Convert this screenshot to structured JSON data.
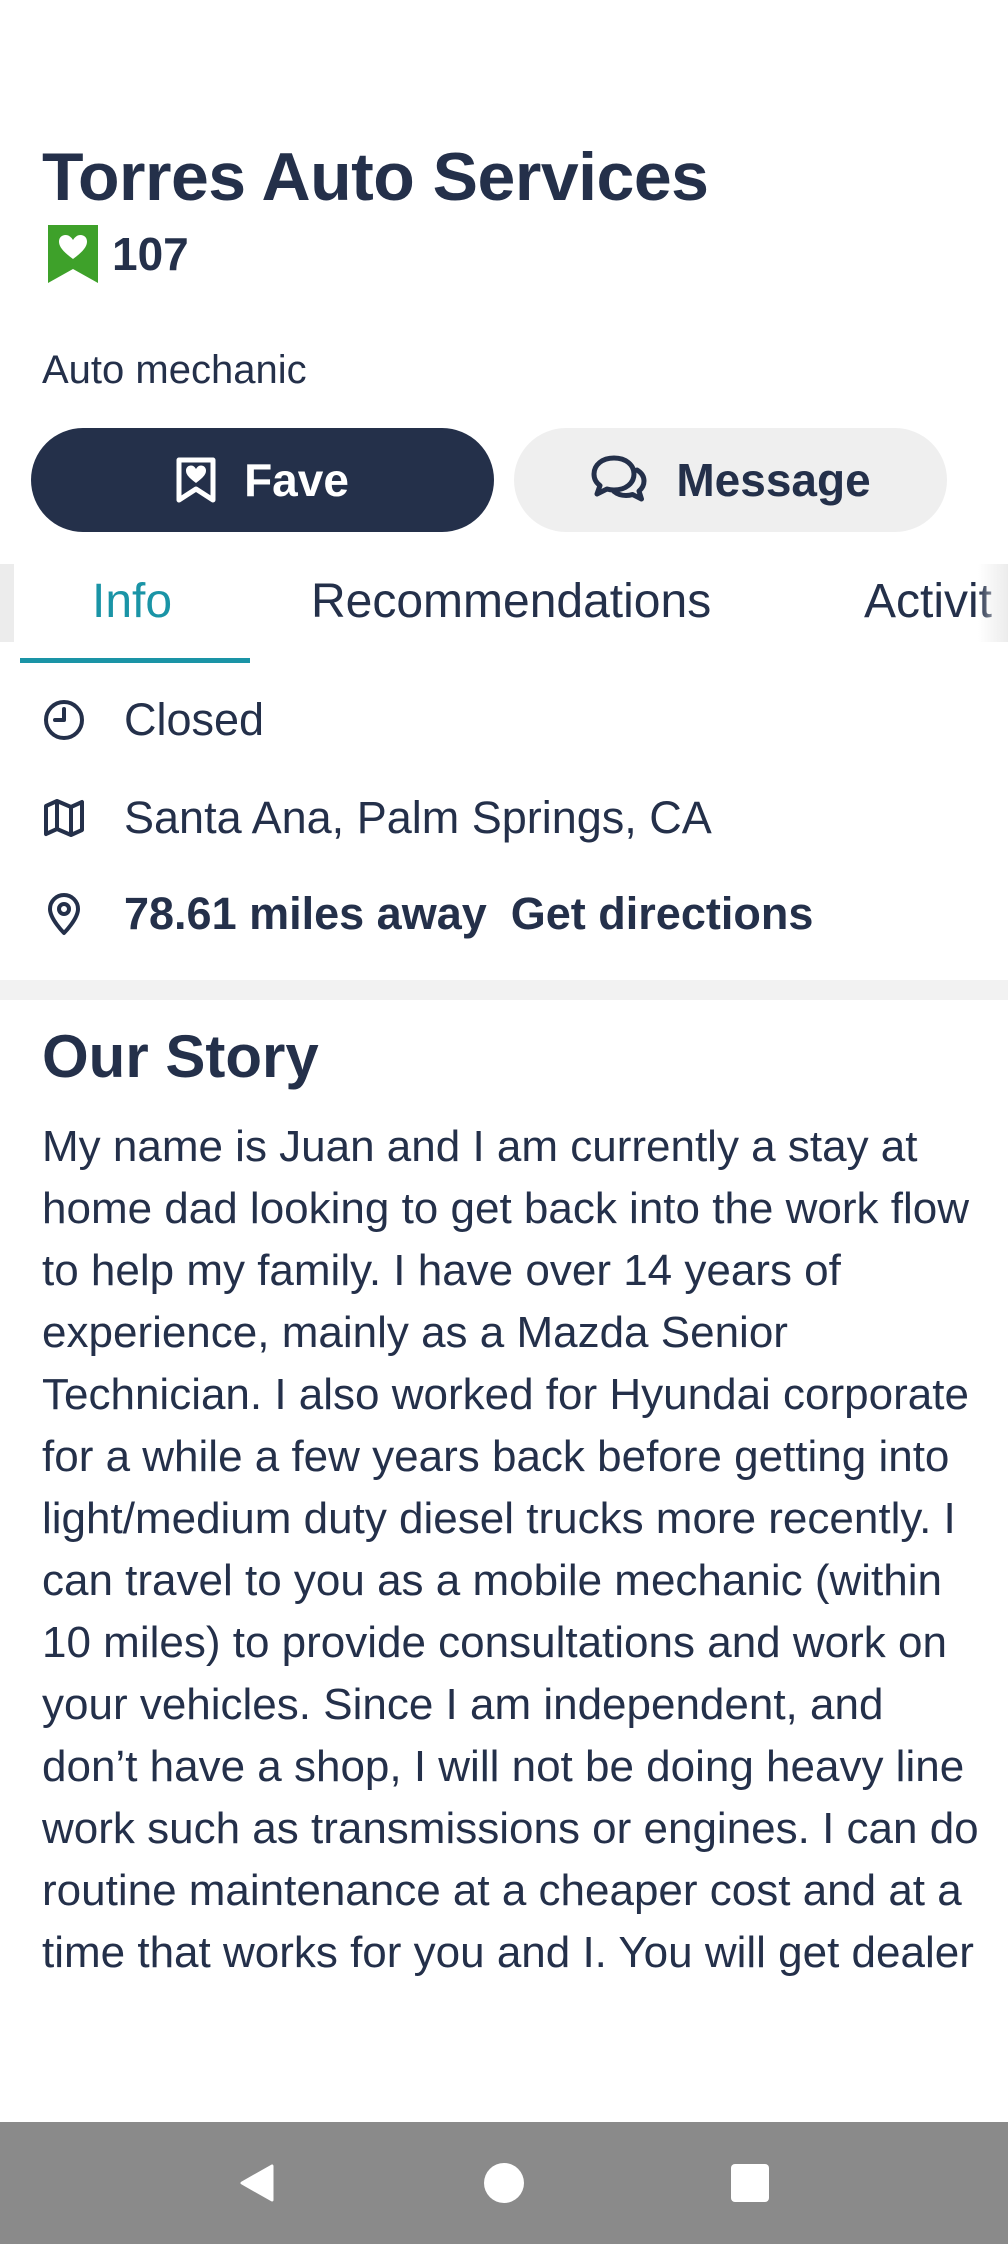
{
  "business": {
    "name": "Torres Auto Services",
    "fave_count": "107",
    "category": "Auto mechanic"
  },
  "actions": {
    "fave_label": "Fave",
    "message_label": "Message"
  },
  "tabs": [
    {
      "label": "Info",
      "selected": true
    },
    {
      "label": "Recommendations",
      "selected": false
    },
    {
      "label": "Activit",
      "selected": false
    }
  ],
  "info": {
    "status": "Closed",
    "location": "Santa Ana, Palm Springs, CA",
    "distance": "78.61 miles away",
    "directions_label": "Get directions"
  },
  "story": {
    "heading": "Our Story",
    "text": "My name is Juan and I am currently a stay at home dad looking to get back into the work flow to help my family. I have over 14 years of experience, mainly as a Mazda Senior Technician. I also worked for Hyundai corporate for a while a few years back before getting into light/medium duty diesel trucks more recently. I can travel to you as a mobile mechanic (within 10 miles) to provide consultations and work on your vehicles. Since I am independent, and don’t have a shop, I will not be doing heavy line work such as transmissions or engines. I can do routine maintenance at a cheaper cost and at a time that works for you and I. You will get dealer"
  },
  "icons": {
    "fave_badge": "heart-bookmark-icon",
    "fave_button": "bookmark-heart-icon",
    "message": "chat-bubbles-icon",
    "status": "clock-icon",
    "location": "map-icon",
    "distance": "map-pin-icon"
  },
  "colors": {
    "primary": "#24304a",
    "accent_teal": "#1a94a6",
    "fave_green": "#3ea12a",
    "button_secondary": "#efefef",
    "navbar": "#8a8a8a"
  }
}
